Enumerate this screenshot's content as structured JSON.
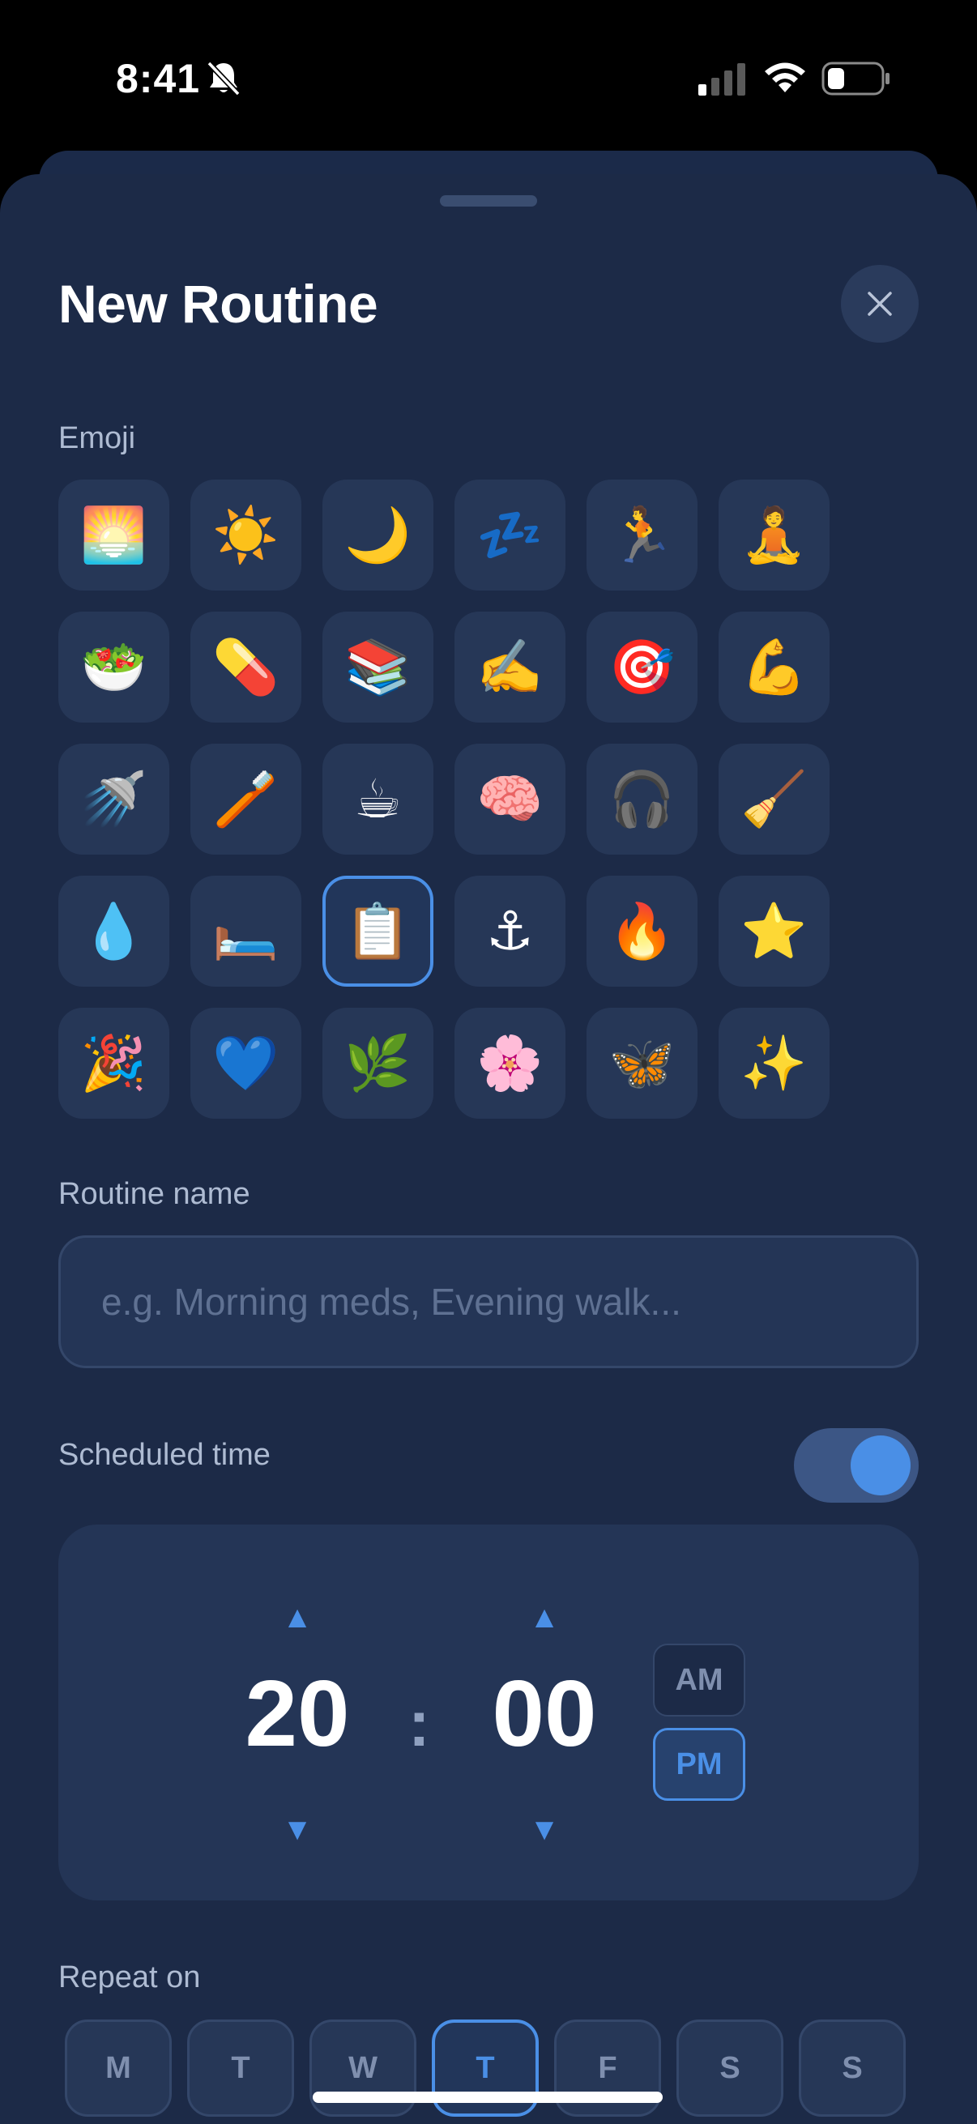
{
  "status_bar": {
    "time": "8:41"
  },
  "sheet": {
    "title": "New Routine"
  },
  "emoji_section": {
    "label": "Emoji",
    "items": [
      {
        "name": "sunrise",
        "glyph": "🌅"
      },
      {
        "name": "sun",
        "glyph": "☀️"
      },
      {
        "name": "crescent-moon",
        "glyph": "🌙"
      },
      {
        "name": "sleeping",
        "glyph": "💤"
      },
      {
        "name": "runner",
        "glyph": "🏃"
      },
      {
        "name": "meditation",
        "glyph": "🧘"
      },
      {
        "name": "salad",
        "glyph": "🥗"
      },
      {
        "name": "pill",
        "glyph": "💊"
      },
      {
        "name": "books",
        "glyph": "📚"
      },
      {
        "name": "writing-hand",
        "glyph": "✍️"
      },
      {
        "name": "target",
        "glyph": "🎯"
      },
      {
        "name": "flexed-biceps",
        "glyph": "💪"
      },
      {
        "name": "shower",
        "glyph": "🚿"
      },
      {
        "name": "toothbrush",
        "glyph": "🪥"
      },
      {
        "name": "coffee",
        "glyph": "☕"
      },
      {
        "name": "brain",
        "glyph": "🧠"
      },
      {
        "name": "headphones",
        "glyph": "🎧"
      },
      {
        "name": "broom",
        "glyph": "🧹"
      },
      {
        "name": "droplet",
        "glyph": "💧"
      },
      {
        "name": "bed",
        "glyph": "🛏️"
      },
      {
        "name": "clipboard",
        "glyph": "📋",
        "selected": true
      },
      {
        "name": "anchor",
        "glyph": "⚓"
      },
      {
        "name": "fire",
        "glyph": "🔥"
      },
      {
        "name": "star",
        "glyph": "⭐"
      },
      {
        "name": "party-popper",
        "glyph": "🎉"
      },
      {
        "name": "blue-heart",
        "glyph": "💙"
      },
      {
        "name": "herb",
        "glyph": "🌿"
      },
      {
        "name": "cherry-blossom",
        "glyph": "🌸"
      },
      {
        "name": "butterfly",
        "glyph": "🦋"
      },
      {
        "name": "sparkles",
        "glyph": "✨"
      }
    ]
  },
  "routine_name": {
    "label": "Routine name",
    "placeholder": "e.g. Morning meds, Evening walk...",
    "value": ""
  },
  "scheduled_time": {
    "label": "Scheduled time",
    "enabled": true,
    "hour": "20",
    "minute": "00",
    "separator": ":",
    "am_label": "AM",
    "pm_label": "PM",
    "period": "PM",
    "up_arrow": "▲",
    "down_arrow": "▼"
  },
  "repeat": {
    "label": "Repeat on",
    "days": [
      {
        "label": "M",
        "selected": false
      },
      {
        "label": "T",
        "selected": false
      },
      {
        "label": "W",
        "selected": false
      },
      {
        "label": "T",
        "selected": true
      },
      {
        "label": "F",
        "selected": false
      },
      {
        "label": "S",
        "selected": false
      },
      {
        "label": "S",
        "selected": false
      }
    ]
  },
  "colors": {
    "accent": "#4a8fe6",
    "sheet_bg": "#1c2a47",
    "cell_bg": "#263757"
  }
}
